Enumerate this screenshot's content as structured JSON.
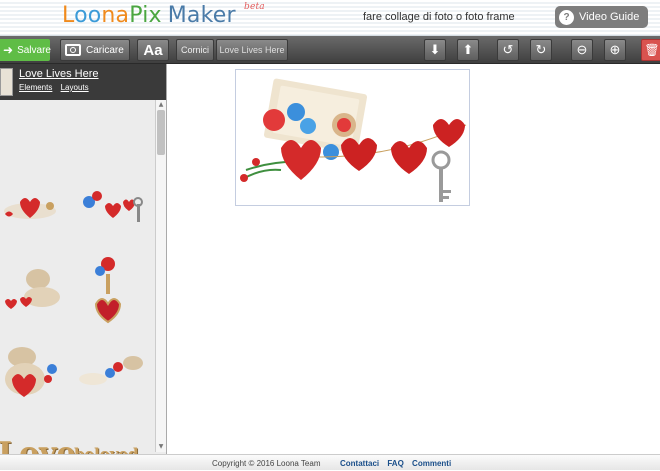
{
  "header": {
    "logo_loona_a": "L",
    "logo_oo": "oo",
    "logo_na": "na",
    "logo_pix": "Pix",
    "logo_maker": "Maker",
    "logo_beta": "beta",
    "tagline": "fare collage di foto o foto frame",
    "video_guide": "Video Guide",
    "video_icon": "?"
  },
  "toolbar": {
    "salvare": "Salvare",
    "caricare": "Caricare",
    "text_tool": "Aa",
    "cornici": "Cornici",
    "frame_name": "Love Lives Here",
    "icons": [
      "download-icon",
      "upload-icon",
      "undo-icon",
      "redo-icon",
      "zoom-out-icon",
      "zoom-in-icon",
      "trash-icon"
    ],
    "glyphs": {
      "down": "⬇",
      "up": "⬆",
      "undo": "↺",
      "redo": "↻",
      "zoom_out": "⊖",
      "zoom_in": "⊕",
      "trash": "🗑"
    }
  },
  "sidebar": {
    "title": "Love Lives Here",
    "links": [
      "Elements",
      "Layouts"
    ],
    "word_love": "Love",
    "word_beloved": "beloved",
    "scroll_up": "▲",
    "scroll_down": "▼"
  },
  "footer": {
    "copyright": "Copyright © 2016 Loona Team",
    "links": [
      "Contattaci",
      "FAQ",
      "Commenti"
    ]
  },
  "colors": {
    "accent_green": "#5fbd46",
    "toolbar": "#3f3f3f",
    "heart_red": "#d42a2a"
  }
}
